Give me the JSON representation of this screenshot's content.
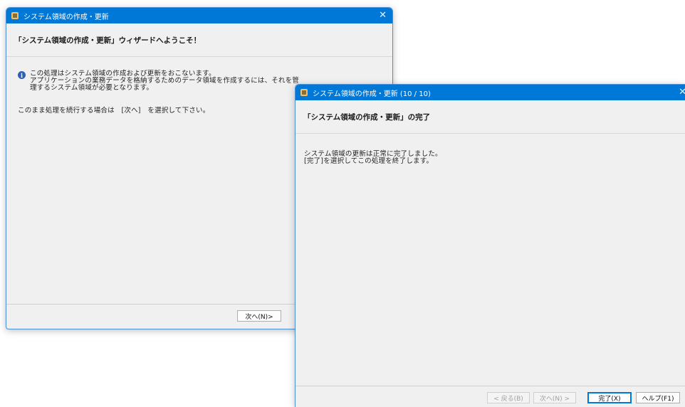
{
  "window1": {
    "title": "システム領域の作成・更新",
    "close_glyph": "✕",
    "header": "「システム領域の作成・更新」ウィザードへようこそ！",
    "info_lines": [
      "この処理はシステム領域の作成および更新をおこないます。",
      "アプリケーションの業務データを格納するためのデータ領域を作成するには、それを管",
      "理するシステム領域が必要となります。"
    ],
    "instruction": "このまま処理を続行する場合は　[次へ]　を選択して下さい。",
    "next_button": "次へ(N)>"
  },
  "window2": {
    "title": "システム領域の作成・更新 (10 / 10)",
    "close_glyph": "✕",
    "header": "「システム領域の作成・更新」の完了",
    "lines": [
      "システム領域の更新は正常に完了しました。",
      "[完了]を選択してこの処理を終了します。"
    ],
    "buttons": {
      "back": "< 戻る(B)",
      "next": "次へ(N) >",
      "finish": "完了(X)",
      "help": "ヘルプ(F1)"
    }
  }
}
